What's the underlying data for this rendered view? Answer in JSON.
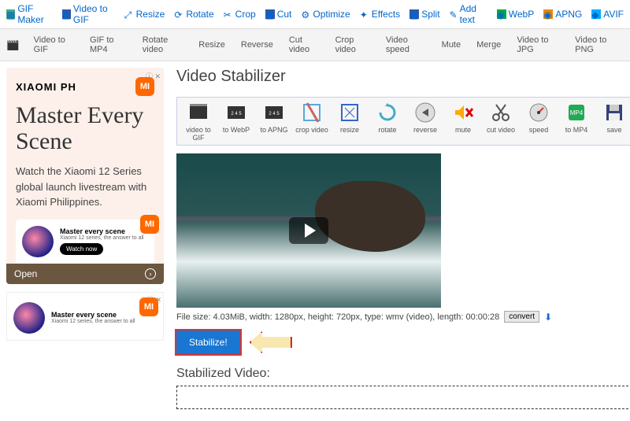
{
  "top_links": [
    {
      "label": "GIF Maker"
    },
    {
      "label": "Video to GIF"
    },
    {
      "label": "Resize"
    },
    {
      "label": "Rotate"
    },
    {
      "label": "Crop"
    },
    {
      "label": "Cut"
    },
    {
      "label": "Optimize"
    },
    {
      "label": "Effects"
    },
    {
      "label": "Split"
    },
    {
      "label": "Add text"
    },
    {
      "label": "WebP"
    },
    {
      "label": "APNG"
    },
    {
      "label": "AVIF"
    }
  ],
  "nav": [
    "Video to GIF",
    "GIF to MP4",
    "Rotate video",
    "Resize",
    "Reverse",
    "Cut video",
    "Crop video",
    "Video speed",
    "Mute",
    "Merge",
    "Video to JPG",
    "Video to PNG"
  ],
  "ad": {
    "brand": "XIAOMI PH",
    "title": "Master Every Scene",
    "desc": "Watch the Xiaomi 12 Series global launch livestream with Xiaomi Philippines.",
    "card_title": "Master every scene",
    "card_sub": "Xiaomi 12 series, the answer to all",
    "watch": "Watch now",
    "open": "Open",
    "close": "ⓘ ✕"
  },
  "page": {
    "title": "Video Stabilizer"
  },
  "tools": [
    {
      "label": "video to GIF"
    },
    {
      "label": "to WebP"
    },
    {
      "label": "to APNG"
    },
    {
      "label": "crop video"
    },
    {
      "label": "resize"
    },
    {
      "label": "rotate"
    },
    {
      "label": "reverse"
    },
    {
      "label": "mute"
    },
    {
      "label": "cut video"
    },
    {
      "label": "speed"
    },
    {
      "label": "to MP4"
    },
    {
      "label": "save"
    }
  ],
  "file_info": "File size: 4.03MiB, width: 1280px, height: 720px, type: wmv (video), length: 00:00:28",
  "convert_label": "convert",
  "stabilize_label": "Stabilize!",
  "stabilized_title": "Stabilized Video:"
}
